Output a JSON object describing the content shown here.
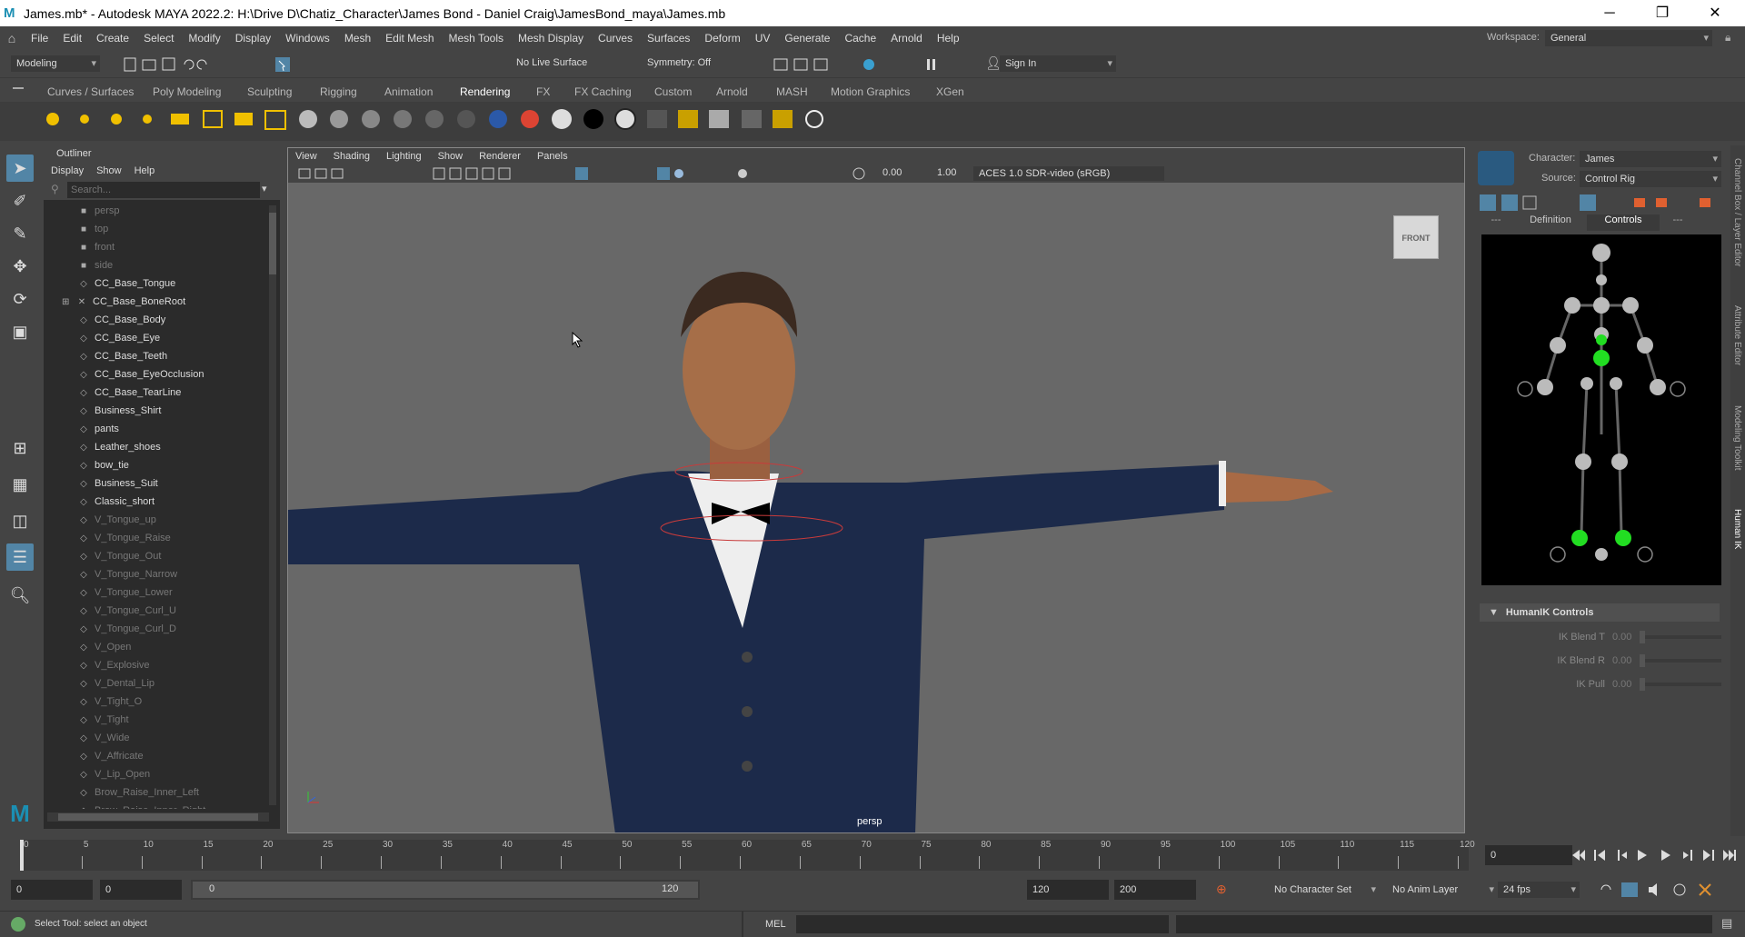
{
  "window": {
    "title": "James.mb* - Autodesk MAYA 2022.2: H:\\Drive D\\Chatiz_Character\\James Bond - Daniel Craig\\JamesBond_maya\\James.mb",
    "minimize": "─",
    "maximize": "❐",
    "close": "✕"
  },
  "menubar": {
    "items": [
      "File",
      "Edit",
      "Create",
      "Select",
      "Modify",
      "Display",
      "Windows",
      "Mesh",
      "Edit Mesh",
      "Mesh Tools",
      "Mesh Display",
      "Curves",
      "Surfaces",
      "Deform",
      "UV",
      "Generate",
      "Cache",
      "Arnold",
      "Help"
    ],
    "workspace_label": "Workspace:",
    "workspace_value": "General"
  },
  "statusline": {
    "menuset": "Modeling",
    "live_surface": "No Live Surface",
    "symmetry": "Symmetry: Off",
    "sign_in": "Sign In"
  },
  "shelf": {
    "tabs": [
      "Curves / Surfaces",
      "Poly Modeling",
      "Sculpting",
      "Rigging",
      "Animation",
      "Rendering",
      "FX",
      "FX Caching",
      "Custom",
      "Arnold",
      "MASH",
      "Motion Graphics",
      "XGen"
    ],
    "active_tab": "Rendering"
  },
  "outliner": {
    "title": "Outliner",
    "menu": [
      "Display",
      "Show",
      "Help"
    ],
    "search_placeholder": "Search...",
    "items": [
      {
        "name": "persp",
        "type": "camera",
        "dim": true
      },
      {
        "name": "top",
        "type": "camera",
        "dim": true
      },
      {
        "name": "front",
        "type": "camera",
        "dim": true
      },
      {
        "name": "side",
        "type": "camera",
        "dim": true
      },
      {
        "name": "CC_Base_Tongue",
        "type": "mesh",
        "dim": false
      },
      {
        "name": "CC_Base_BoneRoot",
        "type": "joint",
        "dim": false
      },
      {
        "name": "CC_Base_Body",
        "type": "mesh",
        "dim": false
      },
      {
        "name": "CC_Base_Eye",
        "type": "mesh",
        "dim": false
      },
      {
        "name": "CC_Base_Teeth",
        "type": "mesh",
        "dim": false
      },
      {
        "name": "CC_Base_EyeOcclusion",
        "type": "mesh",
        "dim": false
      },
      {
        "name": "CC_Base_TearLine",
        "type": "mesh",
        "dim": false
      },
      {
        "name": "Business_Shirt",
        "type": "mesh",
        "dim": false
      },
      {
        "name": "pants",
        "type": "mesh",
        "dim": false
      },
      {
        "name": "Leather_shoes",
        "type": "mesh",
        "dim": false
      },
      {
        "name": "bow_tie",
        "type": "mesh",
        "dim": false
      },
      {
        "name": "Business_Suit",
        "type": "mesh",
        "dim": false
      },
      {
        "name": "Classic_short",
        "type": "mesh",
        "dim": false
      },
      {
        "name": "V_Tongue_up",
        "type": "mesh",
        "dim": true
      },
      {
        "name": "V_Tongue_Raise",
        "type": "mesh",
        "dim": true
      },
      {
        "name": "V_Tongue_Out",
        "type": "mesh",
        "dim": true
      },
      {
        "name": "V_Tongue_Narrow",
        "type": "mesh",
        "dim": true
      },
      {
        "name": "V_Tongue_Lower",
        "type": "mesh",
        "dim": true
      },
      {
        "name": "V_Tongue_Curl_U",
        "type": "mesh",
        "dim": true
      },
      {
        "name": "V_Tongue_Curl_D",
        "type": "mesh",
        "dim": true
      },
      {
        "name": "V_Open",
        "type": "mesh",
        "dim": true
      },
      {
        "name": "V_Explosive",
        "type": "mesh",
        "dim": true
      },
      {
        "name": "V_Dental_Lip",
        "type": "mesh",
        "dim": true
      },
      {
        "name": "V_Tight_O",
        "type": "mesh",
        "dim": true
      },
      {
        "name": "V_Tight",
        "type": "mesh",
        "dim": true
      },
      {
        "name": "V_Wide",
        "type": "mesh",
        "dim": true
      },
      {
        "name": "V_Affricate",
        "type": "mesh",
        "dim": true
      },
      {
        "name": "V_Lip_Open",
        "type": "mesh",
        "dim": true
      },
      {
        "name": "Brow_Raise_Inner_Left",
        "type": "mesh",
        "dim": true
      },
      {
        "name": "Brow_Raise_Inner_Right",
        "type": "mesh",
        "dim": true
      }
    ]
  },
  "viewport": {
    "menu": [
      "View",
      "Shading",
      "Lighting",
      "Show",
      "Renderer",
      "Panels"
    ],
    "exposure": "0.00",
    "gamma": "1.00",
    "color_space": "ACES 1.0 SDR-video (sRGB)",
    "viewcube": "FRONT",
    "camera": "persp"
  },
  "humanik": {
    "character_label": "Character:",
    "character_value": "James",
    "source_label": "Source:",
    "source_value": "Control Rig",
    "tabs": [
      "---",
      "Definition",
      "Controls",
      "---"
    ],
    "active_tab": "Controls",
    "section": "HumanIK Controls",
    "controls": [
      {
        "label": "IK Blend T",
        "value": "0.00"
      },
      {
        "label": "IK Blend R",
        "value": "0.00"
      },
      {
        "label": "IK Pull",
        "value": "0.00"
      }
    ]
  },
  "side_tabs": [
    "Channel Box / Layer Editor",
    "Attribute Editor",
    "Modeling Toolkit",
    "Human IK"
  ],
  "timeslider": {
    "ticks": [
      "0",
      "5",
      "10",
      "15",
      "20",
      "25",
      "30",
      "35",
      "40",
      "45",
      "50",
      "55",
      "60",
      "65",
      "70",
      "75",
      "80",
      "85",
      "90",
      "95",
      "100",
      "105",
      "110",
      "115",
      "120"
    ],
    "current_frame": "0"
  },
  "range": {
    "start": "0",
    "playback_start": "0",
    "slider_start": "0",
    "slider_end": "120",
    "playback_end": "120",
    "end": "200",
    "character_set": "No Character Set",
    "anim_layer": "No Anim Layer",
    "fps": "24 fps"
  },
  "helpline": {
    "message": "Select Tool: select an object",
    "mel_label": "MEL"
  }
}
